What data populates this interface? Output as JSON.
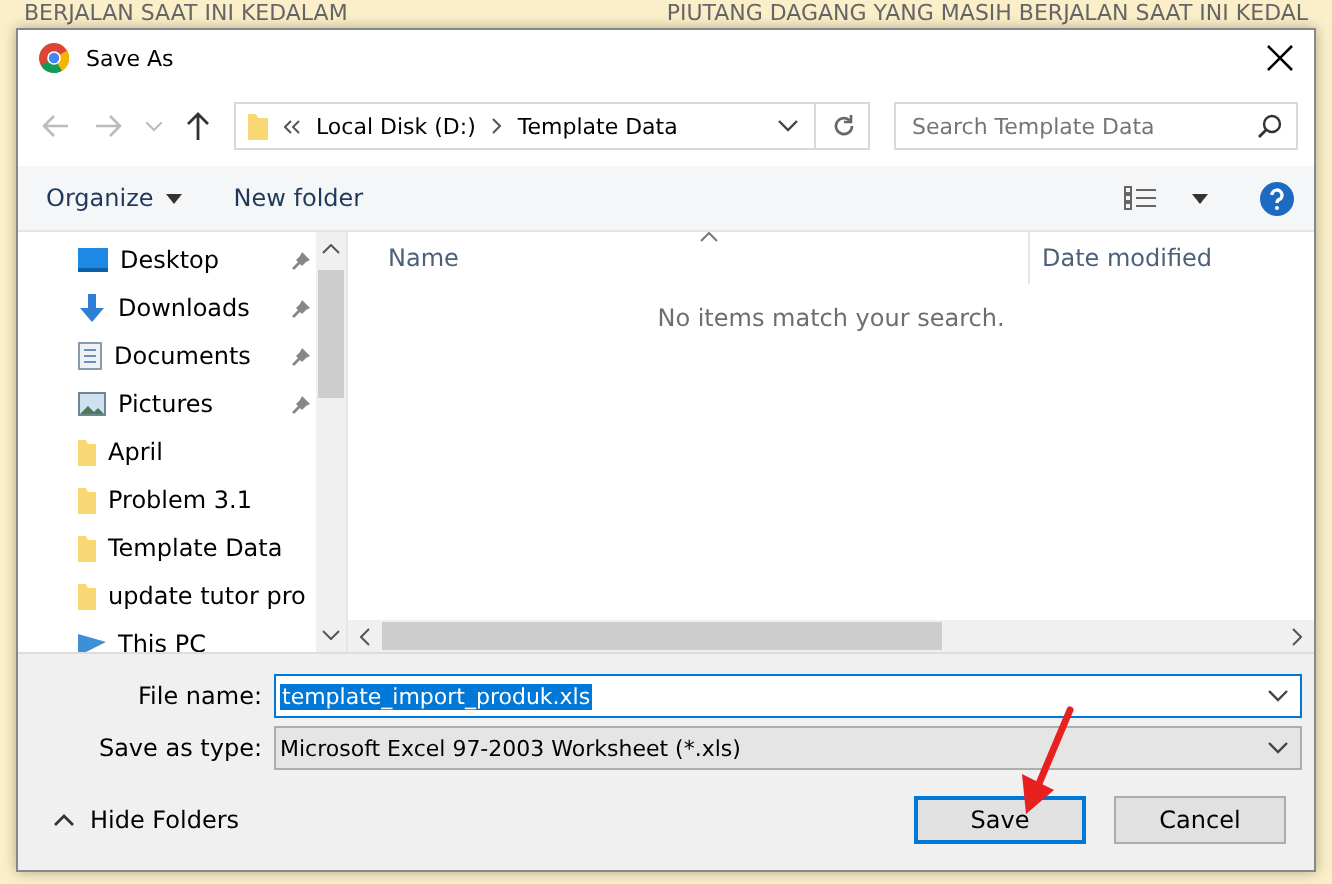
{
  "background": {
    "texts": [
      "BERJALAN SAAT INI KEDALAM",
      "PIUTANG DAGANG YANG MASIH BERJALAN SAAT INI KEDAL"
    ]
  },
  "window": {
    "title": "Save As"
  },
  "address": {
    "crumbs": [
      "Local Disk (D:)",
      "Template Data"
    ]
  },
  "search": {
    "placeholder": "Search Template Data"
  },
  "toolbar": {
    "organize": "Organize",
    "new_folder": "New folder"
  },
  "sidebar": {
    "items": [
      {
        "label": "Desktop",
        "kind": "desktop",
        "pinned": true
      },
      {
        "label": "Downloads",
        "kind": "downloads",
        "pinned": true
      },
      {
        "label": "Documents",
        "kind": "documents",
        "pinned": true
      },
      {
        "label": "Pictures",
        "kind": "pictures",
        "pinned": true
      },
      {
        "label": "April",
        "kind": "folder",
        "pinned": false
      },
      {
        "label": "Problem 3.1",
        "kind": "folder",
        "pinned": false
      },
      {
        "label": "Template Data",
        "kind": "folder",
        "pinned": false
      },
      {
        "label": "update tutor pro",
        "kind": "folder",
        "pinned": false
      },
      {
        "label": "This PC",
        "kind": "pc",
        "pinned": false
      }
    ]
  },
  "table": {
    "columns": [
      "Name",
      "Date modified"
    ],
    "empty_message": "No items match your search."
  },
  "form": {
    "file_name_label": "File name:",
    "file_name": "template_import_produk.xls",
    "type_label": "Save as type:",
    "type": "Microsoft Excel 97-2003 Worksheet (*.xls)"
  },
  "footer": {
    "hide_folders": "Hide Folders",
    "save": "Save",
    "cancel": "Cancel"
  }
}
